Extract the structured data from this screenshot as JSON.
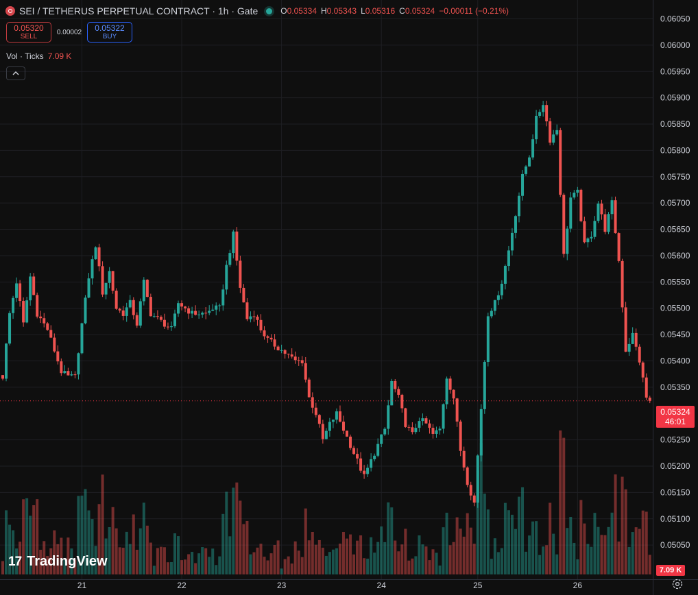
{
  "header": {
    "title": "SEI / TETHERUS PERPETUAL CONTRACT · 1h · Gate",
    "ohlc": [
      {
        "k": "O",
        "v": "0.05334"
      },
      {
        "k": "H",
        "v": "0.05343"
      },
      {
        "k": "L",
        "v": "0.05316"
      },
      {
        "k": "C",
        "v": "0.05324"
      },
      {
        "k": "",
        "v": "−0.00011 (−0.21%)"
      }
    ]
  },
  "trade": {
    "sell_price": "0.05320",
    "sell_label": "SELL",
    "spread": "0.00002",
    "buy_price": "0.05322",
    "buy_label": "BUY"
  },
  "volume_legend": {
    "label": "Vol · Ticks",
    "value": "7.09 K"
  },
  "price_tag": {
    "price": "0.05324",
    "countdown": "46:01"
  },
  "volume_tag": "7.09 K",
  "logo_text": "TradingView",
  "icons": {
    "symbol": "sei-logo-icon",
    "collapse": "chevron-up-icon",
    "settings": "gear-icon",
    "logo": "tradingview-logo-icon",
    "live": "live-dot-icon"
  },
  "colors": {
    "background": "#0f0f0f",
    "up": "#26a69a",
    "down": "#ef5350",
    "grid": "#1e1f23",
    "axis_text": "#d1d4dc",
    "last_price": "#f23645"
  },
  "chart_data": {
    "type": "candlestick",
    "timeframe": "1h",
    "price_axis": {
      "ylim": [
        0.05015,
        0.06065
      ],
      "ticks": [
        "0.06050",
        "0.06000",
        "0.05950",
        "0.05900",
        "0.05850",
        "0.05800",
        "0.05750",
        "0.05700",
        "0.05650",
        "0.05600",
        "0.05550",
        "0.05500",
        "0.05450",
        "0.05400",
        "0.05350",
        "0.05250",
        "0.05200",
        "0.05150",
        "0.05100",
        "0.05050"
      ]
    },
    "time_axis": {
      "ticks": [
        "21",
        "22",
        "23",
        "24",
        "25",
        "26"
      ]
    },
    "last_price": 0.05324,
    "close_path": [
      [
        0,
        0.0537
      ],
      [
        2,
        0.0549
      ],
      [
        4,
        0.0555
      ],
      [
        6,
        0.0547
      ],
      [
        8,
        0.0556
      ],
      [
        10,
        0.0549
      ],
      [
        13,
        0.0546
      ],
      [
        15,
        0.0542
      ],
      [
        17,
        0.0538
      ],
      [
        19,
        0.0537
      ],
      [
        21,
        0.0537
      ],
      [
        23,
        0.0547
      ],
      [
        25,
        0.0556
      ],
      [
        27,
        0.0562
      ],
      [
        29,
        0.0553
      ],
      [
        31,
        0.0557
      ],
      [
        33,
        0.055
      ],
      [
        35,
        0.0549
      ],
      [
        37,
        0.0551
      ],
      [
        39,
        0.0547
      ],
      [
        41,
        0.0555
      ],
      [
        43,
        0.0549
      ],
      [
        45,
        0.0548
      ],
      [
        47,
        0.0547
      ],
      [
        49,
        0.0546
      ],
      [
        51,
        0.0551
      ],
      [
        53,
        0.055
      ],
      [
        55,
        0.0549
      ],
      [
        57,
        0.0549
      ],
      [
        59,
        0.0549
      ],
      [
        61,
        0.055
      ],
      [
        63,
        0.055
      ],
      [
        65,
        0.0558
      ],
      [
        67,
        0.0564
      ],
      [
        69,
        0.0554
      ],
      [
        71,
        0.0548
      ],
      [
        73,
        0.0549
      ],
      [
        75,
        0.0546
      ],
      [
        77,
        0.0544
      ],
      [
        79,
        0.0543
      ],
      [
        81,
        0.0542
      ],
      [
        83,
        0.0541
      ],
      [
        85,
        0.054
      ],
      [
        87,
        0.054
      ],
      [
        89,
        0.0533
      ],
      [
        91,
        0.053
      ],
      [
        93,
        0.0525
      ],
      [
        95,
        0.0528
      ],
      [
        97,
        0.053
      ],
      [
        99,
        0.0527
      ],
      [
        101,
        0.0524
      ],
      [
        103,
        0.0521
      ],
      [
        105,
        0.0518
      ],
      [
        107,
        0.0521
      ],
      [
        109,
        0.0524
      ],
      [
        111,
        0.0527
      ],
      [
        113,
        0.0536
      ],
      [
        115,
        0.0533
      ],
      [
        117,
        0.0528
      ],
      [
        119,
        0.0526
      ],
      [
        121,
        0.0529
      ],
      [
        123,
        0.0528
      ],
      [
        125,
        0.0526
      ],
      [
        127,
        0.0527
      ],
      [
        129,
        0.0537
      ],
      [
        131,
        0.0533
      ],
      [
        133,
        0.0523
      ],
      [
        135,
        0.0517
      ],
      [
        137,
        0.0513
      ],
      [
        139,
        0.0531
      ],
      [
        141,
        0.0549
      ],
      [
        143,
        0.0551
      ],
      [
        145,
        0.0555
      ],
      [
        147,
        0.0561
      ],
      [
        149,
        0.0568
      ],
      [
        151,
        0.0575
      ],
      [
        153,
        0.0579
      ],
      [
        155,
        0.0586
      ],
      [
        157,
        0.0589
      ],
      [
        159,
        0.0582
      ],
      [
        161,
        0.0584
      ],
      [
        163,
        0.056
      ],
      [
        165,
        0.0571
      ],
      [
        167,
        0.0572
      ],
      [
        169,
        0.0562
      ],
      [
        171,
        0.0564
      ],
      [
        173,
        0.057
      ],
      [
        175,
        0.0565
      ],
      [
        177,
        0.057
      ],
      [
        179,
        0.0559
      ],
      [
        181,
        0.0542
      ],
      [
        183,
        0.0545
      ],
      [
        185,
        0.054
      ],
      [
        187,
        0.0533
      ],
      [
        188,
        0.05324
      ]
    ]
  }
}
